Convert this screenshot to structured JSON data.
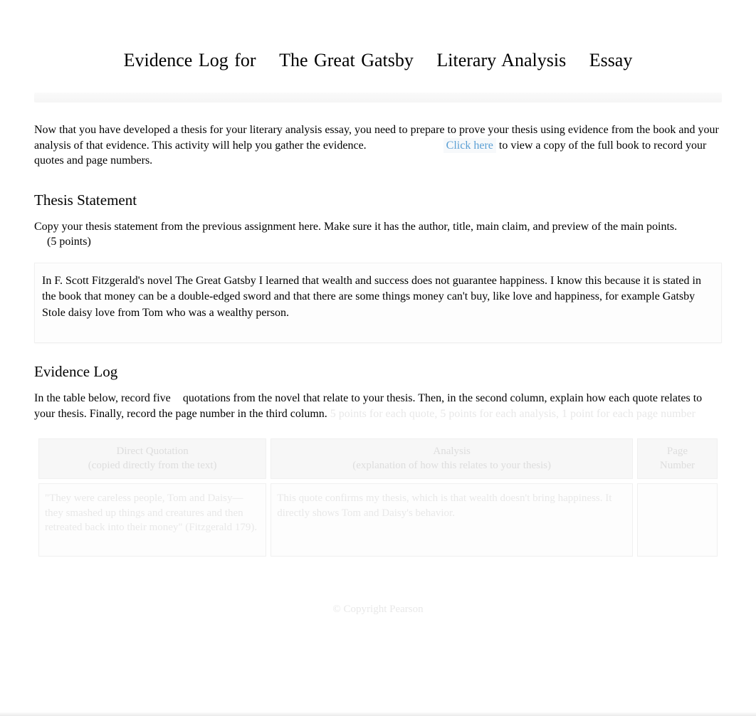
{
  "title": {
    "part1": "Evidence Log for",
    "part2": "The Great Gatsby",
    "part3": "Literary Analysis",
    "part4": "Essay"
  },
  "intro": {
    "text_before_link": "Now that you have developed a thesis for your literary analysis essay, you need to prepare to prove your thesis using evidence from the book and your analysis of that evidence. This activity will help you gather the evidence.",
    "link_label": "Click here",
    "text_after_link": " to view a copy of the full book to record your quotes and page numbers."
  },
  "thesis": {
    "heading": "Thesis Statement",
    "instruction": "Copy your thesis statement from the previous assignment here. Make sure it has the author, title, main claim, and preview of the main points.",
    "points": "(5 points)",
    "content": "In F. Scott Fitzgerald's novel The Great Gatsby I learned that wealth and success does not guarantee happiness. I know this because it is stated in the book that money can be a double-edged sword and that there are some things money can't buy, like love and happiness, for example Gatsby Stole daisy love from Tom who was a wealthy person."
  },
  "evidence": {
    "heading": "Evidence Log",
    "instruction_before_count": "In the table below, record ",
    "count_word": "five",
    "instruction_after_count": " quotations from the novel that relate to your thesis. Then, in the second column, explain how each quote relates to your thesis. Finally, record the page number in the third column.",
    "ghost_trail": "   5 points for each quote, 5 points for each analysis, 1 point for each page number",
    "table": {
      "headers": {
        "col1_line1": "Direct Quotation",
        "col1_line2": "(copied directly from the text)",
        "col2_line1": "Analysis",
        "col2_line2": "(explanation of how this relates to your thesis)",
        "col3_line1": "Page",
        "col3_line2": "Number"
      },
      "rows": [
        {
          "quote": "\"They were careless people, Tom and Daisy—they smashed up things and creatures and then retreated back into their money\" (Fitzgerald 179).",
          "analysis": "This quote confirms my thesis, which is that wealth doesn't bring happiness. It directly shows Tom and Daisy's behavior.",
          "page": ""
        }
      ]
    }
  },
  "footer": "© Copyright Pearson"
}
